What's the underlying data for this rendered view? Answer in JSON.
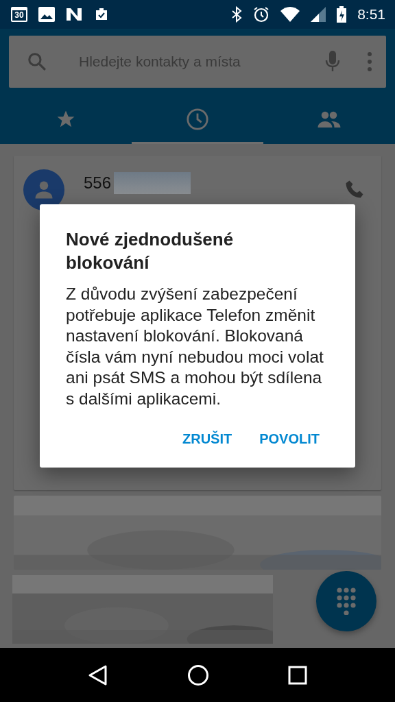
{
  "status_bar": {
    "calendar_day": "30",
    "time": "8:51"
  },
  "search": {
    "placeholder": "Hledejte kontakty a místa"
  },
  "tabs": [
    {
      "kind": "favorites",
      "selected": false
    },
    {
      "kind": "recents",
      "selected": true
    },
    {
      "kind": "contacts",
      "selected": false
    }
  ],
  "call_log": [
    {
      "number": "556"
    }
  ],
  "dialog": {
    "title": "Nové zjednodušené blokování",
    "body": "Z důvodu zvýšení zabezpečení potřebuje aplikace Telefon změnit nastavení blokování. Blokovaná čísla vám nyní nebudou moci volat ani psát SMS a mohou být sdílena s dalšími aplikacemi.",
    "buttons": [
      "ZRUŠIT",
      "POVOLIT"
    ]
  }
}
